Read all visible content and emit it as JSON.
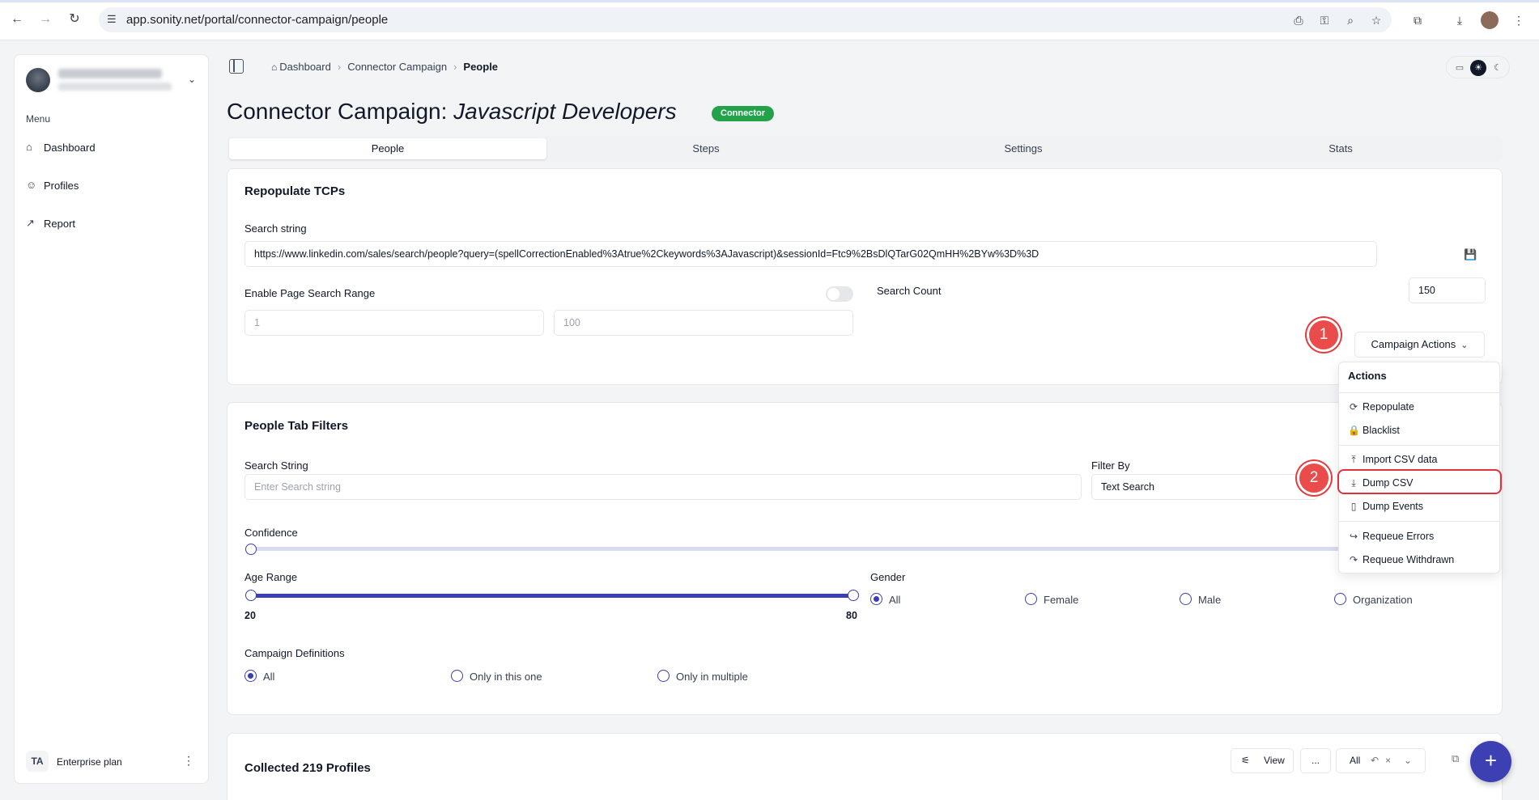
{
  "browser": {
    "url": "app.sonity.net/portal/connector-campaign/people"
  },
  "sidebar": {
    "menu_label": "Menu",
    "items": [
      {
        "label": "Dashboard",
        "icon": "home-icon"
      },
      {
        "label": "Profiles",
        "icon": "users-icon"
      },
      {
        "label": "Report",
        "icon": "chart-icon"
      }
    ],
    "plan_initials": "TA",
    "plan_label": "Enterprise plan"
  },
  "breadcrumb": {
    "items": [
      "Dashboard",
      "Connector Campaign",
      "People"
    ]
  },
  "page": {
    "title_prefix": "Connector Campaign:",
    "title_name": "Javascript Developers",
    "tag": "Connector"
  },
  "tabs": [
    "People",
    "Steps",
    "Settings",
    "Stats"
  ],
  "repopulate": {
    "title": "Repopulate TCPs",
    "search_string_label": "Search string",
    "search_string_value": "https://www.linkedin.com/sales/search/people?query=(spellCorrectionEnabled%3Atrue%2Ckeywords%3AJavascript)&sessionId=Ftc9%2BsDlQTarG02QmHH%2BYw%3D%3D",
    "page_range_label": "Enable Page Search Range",
    "page_from_placeholder": "1",
    "page_to_placeholder": "100",
    "search_count_label": "Search Count",
    "search_count_value": "150",
    "campaign_actions_label": "Campaign Actions"
  },
  "actions_menu": {
    "title": "Actions",
    "items": [
      {
        "label": "Repopulate",
        "icon": "refresh-icon"
      },
      {
        "label": "Blacklist",
        "icon": "lock-icon"
      },
      {
        "label": "Import CSV data",
        "icon": "upload-icon"
      },
      {
        "label": "Dump CSV",
        "icon": "download-icon"
      },
      {
        "label": "Dump Events",
        "icon": "file-icon"
      },
      {
        "label": "Requeue Errors",
        "icon": "redo-icon"
      },
      {
        "label": "Requeue Withdrawn",
        "icon": "redo-curve-icon"
      }
    ]
  },
  "markers": [
    "1",
    "2"
  ],
  "filters": {
    "title": "People Tab Filters",
    "search_label": "Search String",
    "search_placeholder": "Enter Search string",
    "filter_by_label": "Filter By",
    "filter_by_value": "Text Search",
    "confidence_label": "Confidence",
    "age_label": "Age Range",
    "age_min": "20",
    "age_max": "80",
    "gender_label": "Gender",
    "gender_options": [
      "All",
      "Female",
      "Male",
      "Organization"
    ],
    "gender_selected": "All",
    "definitions_label": "Campaign Definitions",
    "definition_options": [
      "All",
      "Only in this one",
      "Only in multiple"
    ],
    "definition_selected": "All"
  },
  "collected": {
    "title": "Collected 219 Profiles",
    "view_label": "View",
    "more_label": "...",
    "filter_value": "All"
  },
  "colors": {
    "accent": "#3c40b2",
    "tag_green": "#22a34a",
    "marker_red": "#ea4b4b"
  }
}
